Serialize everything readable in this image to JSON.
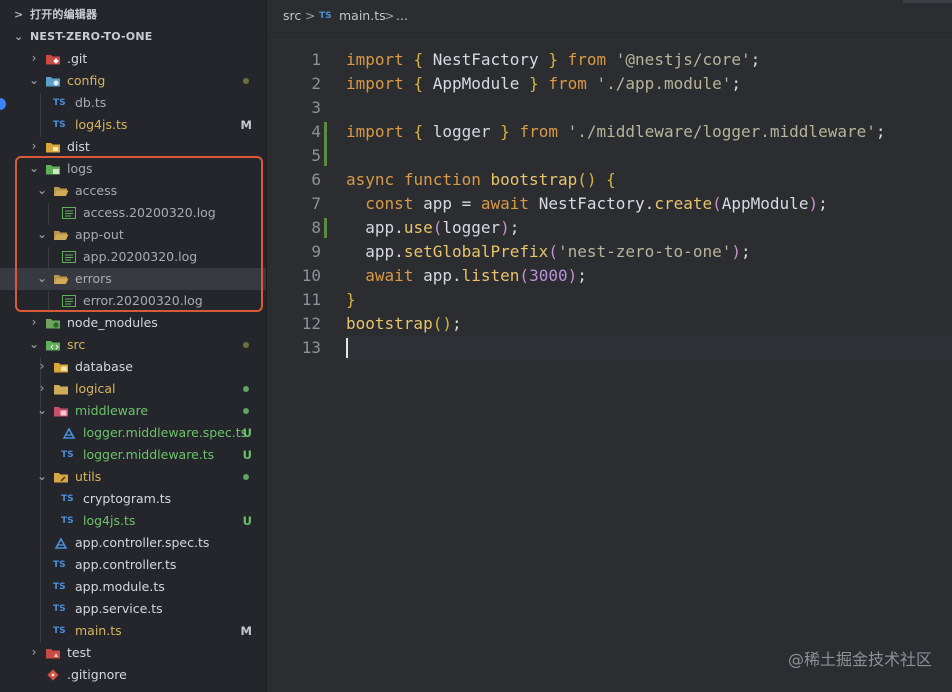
{
  "sidebar": {
    "open_editors_label": "打开的编辑器",
    "project_label": "NEST-ZERO-TO-ONE",
    "items": [
      {
        "label": ".git",
        "badge": ""
      },
      {
        "label": "config",
        "badge": ""
      },
      {
        "label": "db.ts",
        "badge": ""
      },
      {
        "label": "log4js.ts",
        "badge": "M"
      },
      {
        "label": "dist",
        "badge": ""
      },
      {
        "label": "logs",
        "badge": ""
      },
      {
        "label": "access",
        "badge": ""
      },
      {
        "label": "access.20200320.log",
        "badge": ""
      },
      {
        "label": "app-out",
        "badge": ""
      },
      {
        "label": "app.20200320.log",
        "badge": ""
      },
      {
        "label": "errors",
        "badge": ""
      },
      {
        "label": "error.20200320.log",
        "badge": ""
      },
      {
        "label": "node_modules",
        "badge": ""
      },
      {
        "label": "src",
        "badge": ""
      },
      {
        "label": "database",
        "badge": ""
      },
      {
        "label": "logical",
        "badge": ""
      },
      {
        "label": "middleware",
        "badge": ""
      },
      {
        "label": "logger.middleware.spec.ts",
        "badge": "U"
      },
      {
        "label": "logger.middleware.ts",
        "badge": "U"
      },
      {
        "label": "utils",
        "badge": ""
      },
      {
        "label": "cryptogram.ts",
        "badge": ""
      },
      {
        "label": "log4js.ts",
        "badge": "U"
      },
      {
        "label": "app.controller.spec.ts",
        "badge": ""
      },
      {
        "label": "app.controller.ts",
        "badge": ""
      },
      {
        "label": "app.module.ts",
        "badge": ""
      },
      {
        "label": "app.service.ts",
        "badge": ""
      },
      {
        "label": "main.ts",
        "badge": "M"
      },
      {
        "label": "test",
        "badge": ""
      },
      {
        "label": ".gitignore",
        "badge": ""
      }
    ],
    "ts_icon_text": "TS"
  },
  "breadcrumb": {
    "folder": "src",
    "sep": ">",
    "file_icon": "TS",
    "file": "main.ts",
    "tail": "..."
  },
  "editor": {
    "line_numbers": [
      "1",
      "2",
      "3",
      "4",
      "5",
      "6",
      "7",
      "8",
      "9",
      "10",
      "11",
      "12",
      "13"
    ],
    "tokens": {
      "import": "import",
      "from": "from",
      "async": "async",
      "function": "function",
      "const": "const",
      "await": "await",
      "NestFactory": "NestFactory",
      "AppModule": "AppModule",
      "logger": "logger",
      "bootstrap": "bootstrap",
      "app": "app",
      "create": "create",
      "use": "use",
      "setGlobalPrefix": "setGlobalPrefix",
      "listen": "listen",
      "s_core": "'@nestjs/core'",
      "s_module": "'./app.module'",
      "s_logger": "'./middleware/logger.middleware'",
      "s_prefix": "'nest-zero-to-one'",
      "port": "3000"
    }
  },
  "watermark": "@稀土掘金技术社区"
}
